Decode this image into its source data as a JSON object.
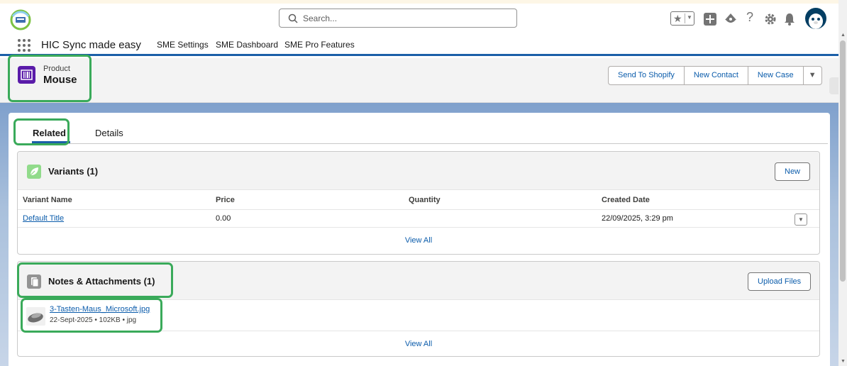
{
  "search": {
    "placeholder": "Search..."
  },
  "app": {
    "name": "HIC Sync made easy",
    "nav": [
      "SME Settings",
      "SME Dashboard",
      "SME Pro Features"
    ]
  },
  "record": {
    "type_label": "Product",
    "name": "Mouse",
    "actions": [
      "Send To Shopify",
      "New Contact",
      "New Case"
    ]
  },
  "tabs": [
    "Related",
    "Details"
  ],
  "variants": {
    "title": "Variants (1)",
    "new_label": "New",
    "columns": [
      "Variant Name",
      "Price",
      "Quantity",
      "Created Date"
    ],
    "rows": [
      {
        "name": "Default Title",
        "price": "0.00",
        "quantity": "",
        "created": "22/09/2025, 3:29 pm"
      }
    ],
    "view_all": "View All"
  },
  "notes": {
    "title": "Notes & Attachments (1)",
    "upload_label": "Upload Files",
    "files": [
      {
        "name": "3-Tasten-Maus_Microsoft.jpg",
        "meta": "22-Sept-2025 • 102KB • jpg"
      }
    ],
    "view_all": "View All"
  },
  "colors": {
    "brand_blue": "#0b5cab",
    "product_icon": "#5a1ba9",
    "variants_icon": "#91db8b",
    "highlight_outline": "#3aaa5a"
  }
}
